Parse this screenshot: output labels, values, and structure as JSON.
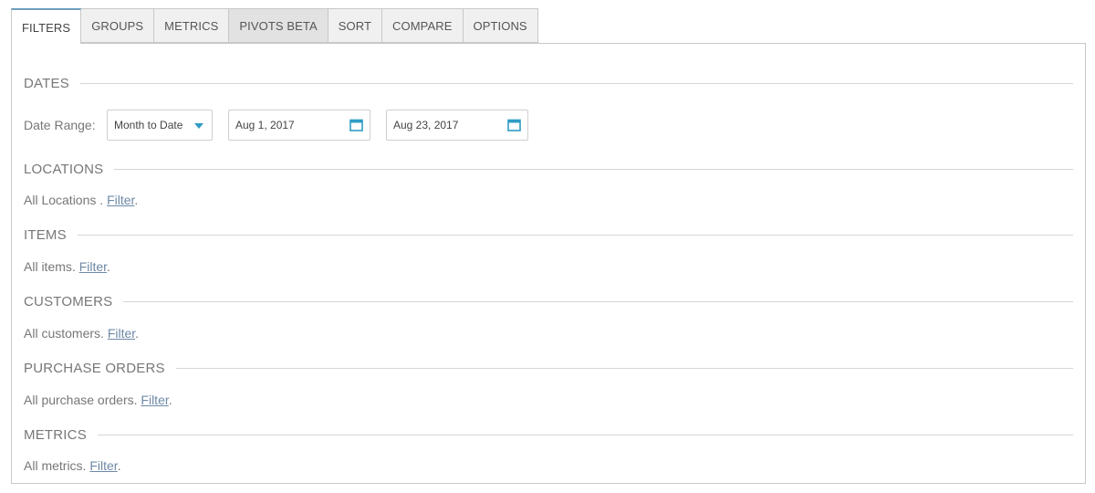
{
  "tabs": [
    {
      "label": "FILTERS"
    },
    {
      "label": "GROUPS"
    },
    {
      "label": "METRICS"
    },
    {
      "label": "PIVOTS BETA"
    },
    {
      "label": "SORT"
    },
    {
      "label": "COMPARE"
    },
    {
      "label": "OPTIONS"
    }
  ],
  "active_tab": "FILTERS",
  "dates": {
    "title": "DATES",
    "range_label": "Date Range:",
    "range_select": "Month to Date",
    "start_date": "Aug 1, 2017",
    "end_date": "Aug 23, 2017"
  },
  "locations": {
    "title": "LOCATIONS",
    "summary": "All Locations .",
    "link": "Filter",
    "end": "."
  },
  "items": {
    "title": "ITEMS",
    "summary": "All items.",
    "link": "Filter",
    "end": "."
  },
  "customers": {
    "title": "CUSTOMERS",
    "summary": "All customers.",
    "link": "Filter",
    "end": "."
  },
  "purchase_orders": {
    "title": "PURCHASE ORDERS",
    "summary": "All purchase orders.",
    "link": "Filter",
    "end": "."
  },
  "metrics": {
    "title": "METRICS",
    "summary": "All metrics.",
    "link": "Filter",
    "end": "."
  },
  "colors": {
    "accent": "#2f9cc4",
    "link": "#6d88a6",
    "active_tab_border": "#6f9fbe"
  },
  "icons": {
    "calendar": "calendar-icon",
    "caret": "chevron-down-icon"
  }
}
